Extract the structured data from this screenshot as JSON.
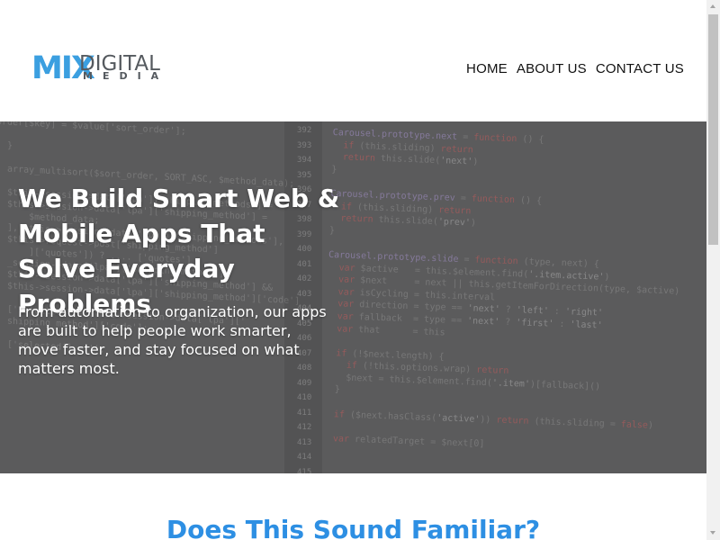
{
  "logo": {
    "mix": "MIX",
    "digital": "DIGITAL",
    "media": "MEDIA"
  },
  "nav": {
    "items": [
      {
        "label": "HOME"
      },
      {
        "label": "ABOUT US"
      },
      {
        "label": "CONTACT US"
      }
    ]
  },
  "hero": {
    "title": "We Build Smart Web & Mobile Apps That Solve Everyday Problems",
    "text": "From automation to organization, our apps are built to help people work smarter, move faster, and stay focused on what matters most."
  },
  "section": {
    "heading": "Does This Sound Familiar?"
  },
  "colors": {
    "brand_blue": "#3b9fe0",
    "heading_blue": "#2d8fe3",
    "logo_gray": "#555a5f",
    "hero_overlay": "#5b5b5c"
  }
}
